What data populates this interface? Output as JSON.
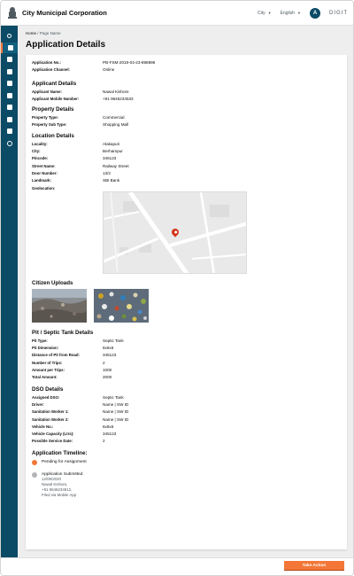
{
  "header": {
    "corporation": "City Municipal Corporation",
    "city_label": "City",
    "language_label": "English",
    "avatar_initial": "A",
    "brand": "DIGIT"
  },
  "breadcrumb": {
    "home": "Home",
    "separator": "/",
    "current": "Page Name"
  },
  "page": {
    "title": "Application Details"
  },
  "application": {
    "rows": [
      {
        "label": "Application No.:",
        "value": "PB-FSM-2019-04-23-898898"
      },
      {
        "label": "Application Channel:",
        "value": "Online"
      }
    ]
  },
  "applicant": {
    "heading": "Applicant Details",
    "rows": [
      {
        "label": "Applicant Name:",
        "value": "Nawal Kishore"
      },
      {
        "label": "Applicant Mobile Number:",
        "value": "+91 9645234533"
      }
    ]
  },
  "property": {
    "heading": "Property Details",
    "rows": [
      {
        "label": "Property Type:",
        "value": "Commercial"
      },
      {
        "label": "Property Sub Type:",
        "value": "Shopping Mall"
      }
    ]
  },
  "location": {
    "heading": "Location Details",
    "rows": [
      {
        "label": "Locality:",
        "value": "Alakapuri"
      },
      {
        "label": "City:",
        "value": "Berhampur"
      },
      {
        "label": "Pincode:",
        "value": "345123"
      },
      {
        "label": "Street Name:",
        "value": "Railway Street"
      },
      {
        "label": "Door Number:",
        "value": "13/2"
      },
      {
        "label": "Landmark:",
        "value": "SBI Bank"
      }
    ],
    "geolocation_label": "Geolocation:"
  },
  "uploads": {
    "heading": "Citizen Uploads"
  },
  "pit": {
    "heading": "Pit / Septic Tank Details",
    "rows": [
      {
        "label": "Pit Type:",
        "value": "Septic Tank"
      },
      {
        "label": "Pit Dimension:",
        "value": "6x6x6"
      },
      {
        "label": "Distance of Pit from Road:",
        "value": "345123"
      },
      {
        "label": "Number of Trips:",
        "value": "2"
      },
      {
        "label": "Amount per Trips:",
        "value": "1000"
      },
      {
        "label": "Total Amount:",
        "value": "2000"
      }
    ]
  },
  "dso": {
    "heading": "DSO Details",
    "rows": [
      {
        "label": "Assigned DSO:",
        "value": "Septic Tank"
      },
      {
        "label": "Driver:",
        "value": "Name | SW ID"
      },
      {
        "label": "Sanitation Worker 1:",
        "value": "Name | SW ID"
      },
      {
        "label": "Sanitation Worker 2:",
        "value": "Name | SW ID"
      },
      {
        "label": "Vehicle No.:",
        "value": "6x6x6"
      },
      {
        "label": "Vehicle Capacity (Ltrs):",
        "value": "345123"
      },
      {
        "label": "Possible Service Date:",
        "value": "2"
      }
    ]
  },
  "timeline": {
    "heading": "Application Timeline:",
    "items": [
      {
        "title": "Pending for Assignment",
        "color": "#f47738",
        "details": []
      },
      {
        "title": "Application Submitted",
        "color": "#b1b4b6",
        "details": [
          "12/08/2020",
          "Nawal Kishore,",
          "+91 9645234512,",
          "Filed via Mobile App"
        ]
      }
    ]
  },
  "footer": {
    "take_action": "Take Action"
  },
  "colors": {
    "sidebar": "#0b4b66",
    "accent": "#f47738",
    "background": "#eeeeee"
  }
}
